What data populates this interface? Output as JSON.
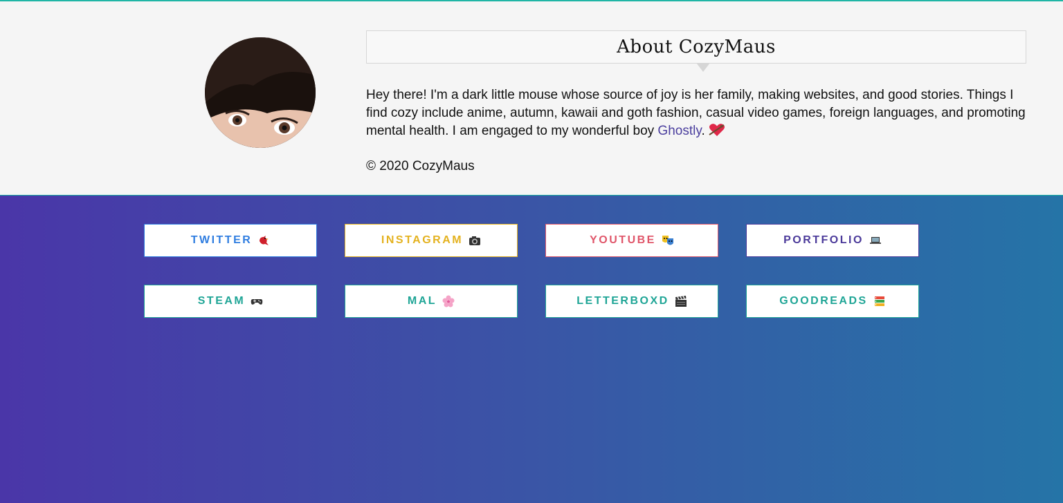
{
  "about": {
    "title": "About CozyMaus",
    "bio_text": "Hey there! I'm a dark little mouse whose source of joy is her family, making websites, and good stories. Things I find cozy include anime, autumn, kawaii and goth fashion, casual video games, foreign languages, and promoting mental health. I am engaged to my wonderful boy ",
    "bio_link": "Ghostly",
    "bio_end": ".",
    "bio_icon": "heart-with-arrow-icon",
    "copyright": "© 2020 CozyMaus"
  },
  "colors": {
    "accent_teal": "#1fb5a5",
    "gradient_start": "#4a36a8",
    "gradient_end": "#2574a7"
  },
  "links": [
    {
      "label": "TWITTER",
      "color": "#2f7de0",
      "icon": "bird-icon"
    },
    {
      "label": "INSTAGRAM",
      "color": "#e4b21f",
      "icon": "camera-icon"
    },
    {
      "label": "YOUTUBE",
      "color": "#e0566a",
      "icon": "performing-arts-icon"
    },
    {
      "label": "PORTFOLIO",
      "color": "#4b3a9a",
      "icon": "laptop-icon"
    },
    {
      "label": "STEAM",
      "color": "#1fa596",
      "icon": "gamepad-icon"
    },
    {
      "label": "MAL",
      "color": "#1fa596",
      "icon": "cherry-blossom-icon"
    },
    {
      "label": "LETTERBOXD",
      "color": "#1fa596",
      "icon": "clapper-board-icon"
    },
    {
      "label": "GOODREADS",
      "color": "#1fa596",
      "icon": "books-icon"
    }
  ]
}
